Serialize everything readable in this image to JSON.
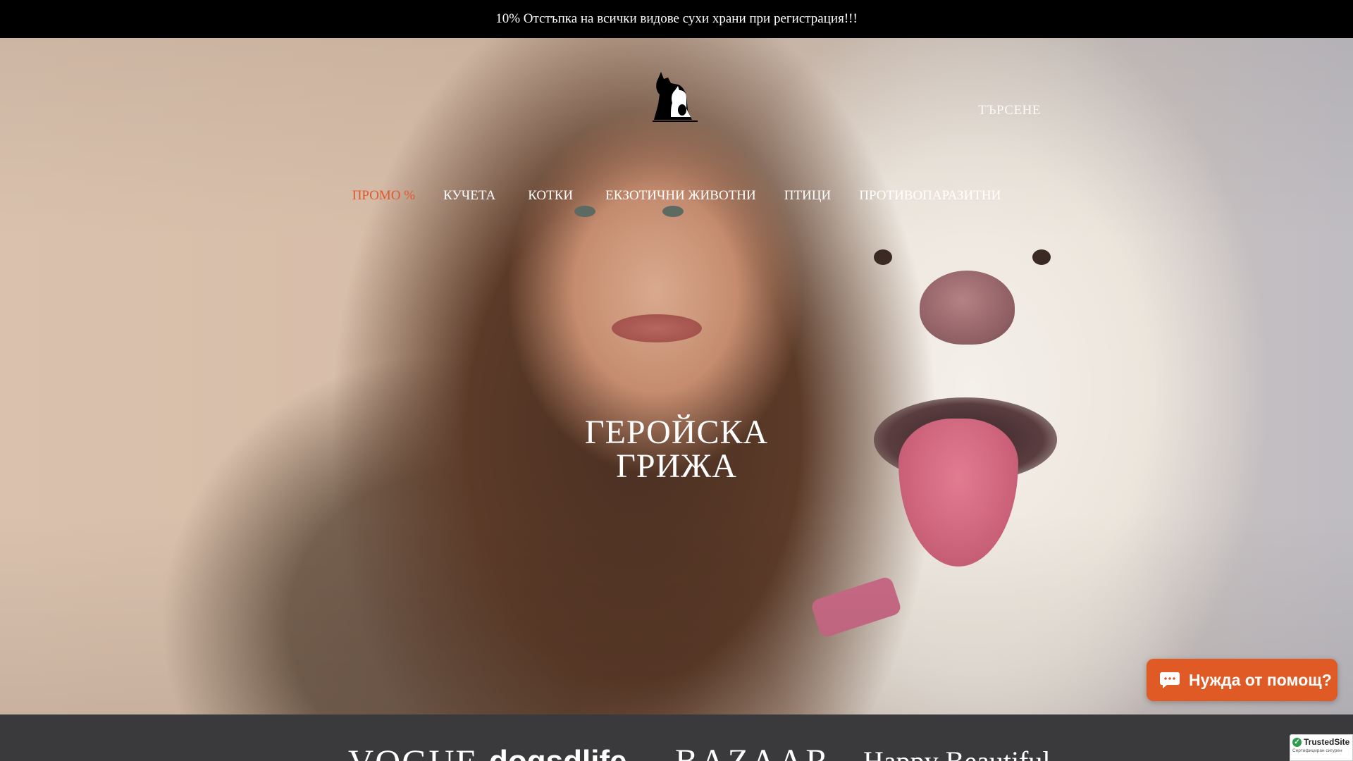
{
  "announcement": {
    "text": "10% Отстъпка на всички видове сухи храни при регистрация!!!"
  },
  "header": {
    "logo_icon": "dog-and-cat-silhouette",
    "search_label": "ТЪРСЕНЕ"
  },
  "nav": {
    "items": [
      {
        "label": "ПРОМО %",
        "accent": true
      },
      {
        "label": "КУЧЕТА"
      },
      {
        "label": "КОТКИ"
      },
      {
        "label": "ЕКЗОТИЧНИ ЖИВОТНИ"
      },
      {
        "label": "ПТИЦИ"
      },
      {
        "label": "ПРОТИВОПАРАЗИТНИ"
      }
    ]
  },
  "hero": {
    "title_line1": "ГЕРОЙСКА",
    "title_line2": "ГРИЖА"
  },
  "chat": {
    "label": "Нужда от помощ?",
    "icon": "chat-bubble-icon"
  },
  "press": {
    "logos": [
      "VOGUE",
      "dogsdlife",
      "BAZAAR",
      "Happy Beautiful"
    ]
  },
  "trust_badge": {
    "title": "TrustedSite",
    "subtitle": "Сертифициран сигурен"
  },
  "colors": {
    "announcement_bg": "#000000",
    "accent": "#e0582c",
    "chat_button": "#e05a26",
    "press_bar": "#3a3a3c"
  }
}
